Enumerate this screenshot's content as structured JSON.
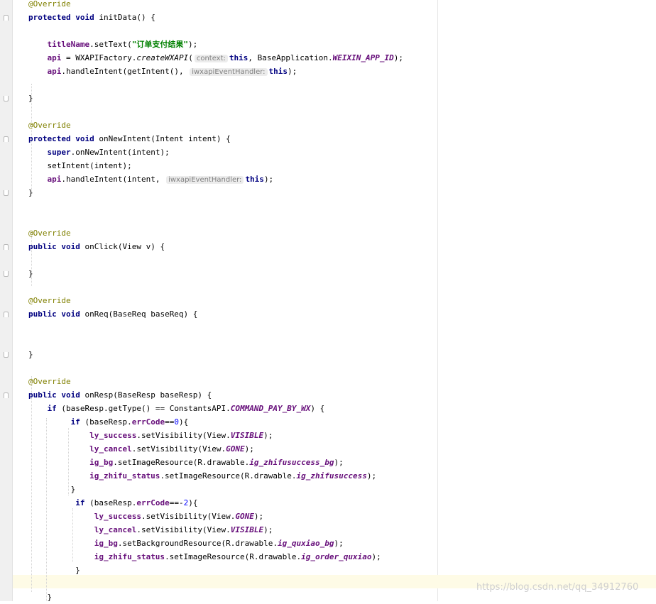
{
  "colors": {
    "keyword": "#000080",
    "annotation": "#808000",
    "field": "#660e7a",
    "string": "#008000",
    "number": "#0000ff",
    "hint_bg": "#ececec",
    "current_line": "#fefbe6"
  },
  "code_lines": [
    [
      {
        "t": "@Override",
        "c": "ann"
      }
    ],
    [
      {
        "t": "protected void",
        "c": "kw"
      },
      {
        "t": " initData() {"
      }
    ],
    [],
    [
      {
        "t": "    "
      },
      {
        "t": "titleName",
        "c": "fld"
      },
      {
        "t": ".setText("
      },
      {
        "t": "\"订单支付结果\"",
        "c": "str"
      },
      {
        "t": ");"
      }
    ],
    [
      {
        "t": "    "
      },
      {
        "t": "api",
        "c": "fld"
      },
      {
        "t": " = WXAPIFactory."
      },
      {
        "t": "createWXAPI",
        "c": "it"
      },
      {
        "t": "("
      },
      {
        "t": "context:",
        "c": "hint"
      },
      {
        "t": "this",
        "c": "kw"
      },
      {
        "t": ", BaseApplication."
      },
      {
        "t": "WEIXIN_APP_ID",
        "c": "st"
      },
      {
        "t": ");"
      }
    ],
    [
      {
        "t": "    "
      },
      {
        "t": "api",
        "c": "fld"
      },
      {
        "t": ".handleIntent(getIntent(), "
      },
      {
        "t": "iwxapiEventHandler:",
        "c": "hint"
      },
      {
        "t": "this",
        "c": "kw"
      },
      {
        "t": ");"
      }
    ],
    [],
    [
      {
        "t": "}"
      }
    ],
    [],
    [
      {
        "t": "@Override",
        "c": "ann"
      }
    ],
    [
      {
        "t": "protected void",
        "c": "kw"
      },
      {
        "t": " onNewIntent(Intent intent) {"
      }
    ],
    [
      {
        "t": "    "
      },
      {
        "t": "super",
        "c": "kw"
      },
      {
        "t": ".onNewIntent(intent);"
      }
    ],
    [
      {
        "t": "    setIntent(intent);"
      }
    ],
    [
      {
        "t": "    "
      },
      {
        "t": "api",
        "c": "fld"
      },
      {
        "t": ".handleIntent(intent, "
      },
      {
        "t": "iwxapiEventHandler:",
        "c": "hint"
      },
      {
        "t": "this",
        "c": "kw"
      },
      {
        "t": ");"
      }
    ],
    [
      {
        "t": "}"
      }
    ],
    [],
    [],
    [
      {
        "t": "@Override",
        "c": "ann"
      }
    ],
    [
      {
        "t": "public void",
        "c": "kw"
      },
      {
        "t": " onClick(View v) {"
      }
    ],
    [],
    [
      {
        "t": "}"
      }
    ],
    [],
    [
      {
        "t": "@Override",
        "c": "ann"
      }
    ],
    [
      {
        "t": "public void",
        "c": "kw"
      },
      {
        "t": " onReq(BaseReq baseReq) {"
      }
    ],
    [],
    [],
    [
      {
        "t": "}"
      }
    ],
    [],
    [
      {
        "t": "@Override",
        "c": "ann"
      }
    ],
    [
      {
        "t": "public void",
        "c": "kw"
      },
      {
        "t": " onResp(BaseResp baseResp) {"
      }
    ],
    [
      {
        "t": "    "
      },
      {
        "t": "if",
        "c": "kw"
      },
      {
        "t": " (baseResp.getType() == ConstantsAPI."
      },
      {
        "t": "COMMAND_PAY_BY_WX",
        "c": "st"
      },
      {
        "t": ") {"
      }
    ],
    [
      {
        "t": "         "
      },
      {
        "t": "if",
        "c": "kw"
      },
      {
        "t": " (baseResp."
      },
      {
        "t": "errCode",
        "c": "fld"
      },
      {
        "t": "=="
      },
      {
        "t": "0",
        "c": "num"
      },
      {
        "t": "){"
      }
    ],
    [
      {
        "t": "             "
      },
      {
        "t": "ly_success",
        "c": "fld"
      },
      {
        "t": ".setVisibility(View."
      },
      {
        "t": "VISIBLE",
        "c": "st"
      },
      {
        "t": ");"
      }
    ],
    [
      {
        "t": "             "
      },
      {
        "t": "ly_cancel",
        "c": "fld"
      },
      {
        "t": ".setVisibility(View."
      },
      {
        "t": "GONE",
        "c": "st"
      },
      {
        "t": ");"
      }
    ],
    [
      {
        "t": "             "
      },
      {
        "t": "ig_bg",
        "c": "fld"
      },
      {
        "t": ".setImageResource(R.drawable."
      },
      {
        "t": "ig_zhifusuccess_bg",
        "c": "st"
      },
      {
        "t": ");"
      }
    ],
    [
      {
        "t": "             "
      },
      {
        "t": "ig_zhifu_status",
        "c": "fld"
      },
      {
        "t": ".setImageResource(R.drawable."
      },
      {
        "t": "ig_zhifusuccess",
        "c": "st"
      },
      {
        "t": ");"
      }
    ],
    [
      {
        "t": "         }"
      }
    ],
    [
      {
        "t": "          "
      },
      {
        "t": "if",
        "c": "kw"
      },
      {
        "t": " (baseResp."
      },
      {
        "t": "errCode",
        "c": "fld"
      },
      {
        "t": "==-"
      },
      {
        "t": "2",
        "c": "num"
      },
      {
        "t": "){"
      }
    ],
    [
      {
        "t": "              "
      },
      {
        "t": "ly_success",
        "c": "fld"
      },
      {
        "t": ".setVisibility(View."
      },
      {
        "t": "GONE",
        "c": "st"
      },
      {
        "t": ");"
      }
    ],
    [
      {
        "t": "              "
      },
      {
        "t": "ly_cancel",
        "c": "fld"
      },
      {
        "t": ".setVisibility(View."
      },
      {
        "t": "VISIBLE",
        "c": "st"
      },
      {
        "t": ");"
      }
    ],
    [
      {
        "t": "              "
      },
      {
        "t": "ig_bg",
        "c": "fld"
      },
      {
        "t": ".setBackgroundResource(R.drawable."
      },
      {
        "t": "ig_quxiao_bg",
        "c": "st"
      },
      {
        "t": ");"
      }
    ],
    [
      {
        "t": "              "
      },
      {
        "t": "ig_zhifu_status",
        "c": "fld"
      },
      {
        "t": ".setImageResource(R.drawable."
      },
      {
        "t": "ig_order_quxiao",
        "c": "st"
      },
      {
        "t": ");"
      }
    ],
    [
      {
        "t": "          }"
      }
    ],
    [],
    [
      {
        "t": "    }"
      }
    ]
  ],
  "watermark": "https://blog.csdn.net/qq_34912760"
}
